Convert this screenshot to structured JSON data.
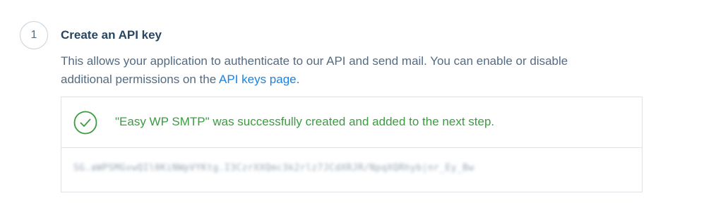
{
  "step": {
    "number": "1",
    "title": "Create an API key",
    "description_before_link": "This allows your application to authenticate to our API and send mail. You can enable or disable additional permissions on the ",
    "link_text": "API keys page",
    "description_after_link": "."
  },
  "result": {
    "success_message": "\"Easy WP SMTP\" was successfully created and added to the next step.",
    "success_icon": "check-circle-icon",
    "api_key_value": "SG.aWPSMGvwQIl0KiNWpVYKtg.I3CzrXXQmc3k2rlz7JCdXRJR/NpqXQRhyb|nr_Ey_Bw",
    "api_key_blurred": true
  },
  "colors": {
    "title": "#294661",
    "body_text": "#546b81",
    "link": "#1a82e2",
    "success": "#3a9c3f",
    "border": "#dfe3e8"
  }
}
